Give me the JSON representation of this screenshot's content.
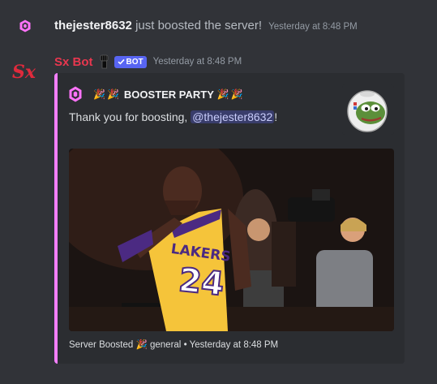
{
  "system_message": {
    "username": "thejester8632",
    "text": "just boosted the server!",
    "timestamp": "Yesterday at 8:48 PM",
    "icon": "boost-gem-icon"
  },
  "bot_message": {
    "author": "Sx Bot",
    "badge": "BOT",
    "timestamp": "Yesterday at 8:48 PM",
    "avatar_text": "Sx",
    "author_color": "#e8374f",
    "embed": {
      "accent_color": "#f47fff",
      "party_emoji": "🎉",
      "title": "BOOSTER PARTY",
      "description_prefix": "Thank you for boosting, ",
      "mention": "@thejester8632",
      "description_suffix": "!",
      "thumbnail": "pepe-astronaut-emoji",
      "image": "basketball-player-photo",
      "jersey_text": "LAKERS",
      "jersey_number": "24",
      "footer_prefix": "Server Boosted",
      "footer_channel": "general",
      "footer_separator": "•",
      "footer_timestamp": "Yesterday at 8:48 PM"
    }
  }
}
